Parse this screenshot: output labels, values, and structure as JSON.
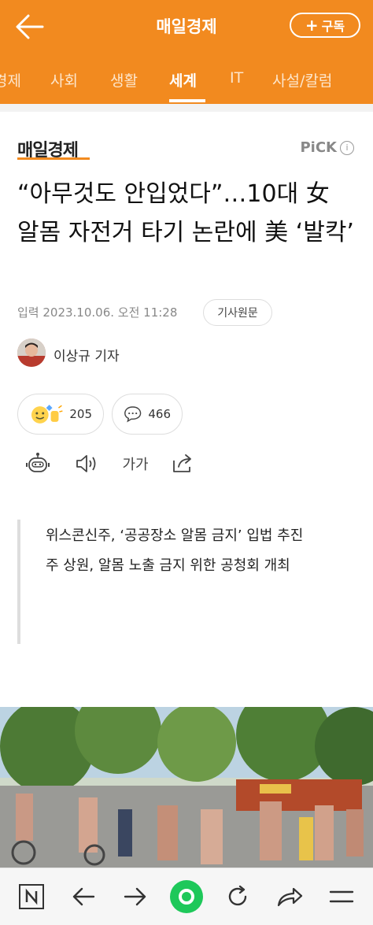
{
  "header": {
    "title": "매일경제",
    "subscribe_label": "구독"
  },
  "nav": {
    "items": [
      {
        "label": "경제"
      },
      {
        "label": "사회"
      },
      {
        "label": "생활"
      },
      {
        "label": "세계"
      },
      {
        "label": "IT"
      },
      {
        "label": "사설/칼럼"
      }
    ],
    "active": "세계"
  },
  "article": {
    "source_logo": "매일경제",
    "pick_label": "PiCK",
    "headline": "“아무것도 안입었다”…10대 女 알몸 자전거 타기 논란에 美 ‘발칵’",
    "date": "입력 2023.10.06. 오전 11:28",
    "original_button": "기사원문",
    "reporter": "이상규 기자",
    "reaction_count": "205",
    "comment_count": "466",
    "font_size_label": "가가",
    "summary": [
      "위스콘신주, ‘공공장소 알몸 금지’ 입법 추진",
      "주 상원, 알몸 노출 금지 위한 공청회 개최"
    ]
  },
  "icons": {
    "back": "arrow-left-icon",
    "plus": "plus-icon",
    "info": "info-icon",
    "reaction": "smile-emoji-icon",
    "comment": "speech-bubble-icon",
    "tts": "robot-icon",
    "audio": "speaker-icon",
    "share": "share-icon"
  },
  "colors": {
    "brand": "#f28a1f",
    "accent": "#1ec85a"
  }
}
